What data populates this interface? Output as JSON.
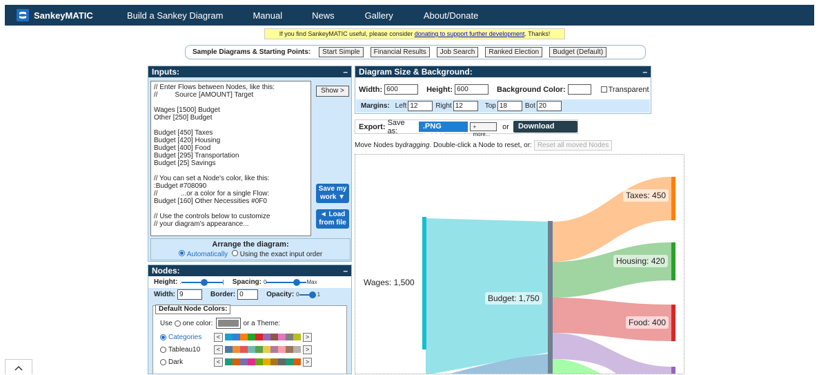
{
  "nav": {
    "brand": "SankeyMATIC",
    "items": [
      "Build a Sankey Diagram",
      "Manual",
      "News",
      "Gallery",
      "About/Donate"
    ]
  },
  "notice": {
    "before": "If you find SankeyMATIC useful, please consider ",
    "link": "donating to support further development",
    "after": ". Thanks!"
  },
  "samples": {
    "label": "Sample Diagrams & Starting Points:",
    "buttons": [
      "Start Simple",
      "Financial Results",
      "Job Search",
      "Ranked Election",
      "Budget (Default)"
    ]
  },
  "inputs": {
    "title": "Inputs:",
    "collapse": "–",
    "text": "// Enter Flows between Nodes, like this:\n//         Source [AMOUNT] Target\n\nWages [1500] Budget\nOther [250] Budget\n\nBudget [450] Taxes\nBudget [420] Housing\nBudget [400] Food\nBudget [295] Transportation\nBudget [25] Savings\n\n// You can set a Node's color, like this:\n:Budget #708090\n//            ...or a color for a single Flow:\nBudget [160] Other Necessities #0F0\n\n// Use the controls below to customize\n// your diagram's appearance...",
    "show_label": "Show >",
    "save_line1": "Save my",
    "save_line2": "work ▼",
    "load_line1": "◄ Load",
    "load_line2": "from file"
  },
  "arrange": {
    "title": "Arrange the diagram:",
    "option_auto": "Automatically",
    "option_exact": "Using the exact input order"
  },
  "nodes": {
    "title": "Nodes:",
    "collapse": "–",
    "height_label": "Height:",
    "height_min": ".",
    "height_max": "|",
    "height_value": 0.55,
    "spacing_label": "Spacing:",
    "spacing_min": "0",
    "spacing_max": "Max",
    "spacing_value": 0.75,
    "width_label": "Width:",
    "width_value": "9",
    "border_label": "Border:",
    "border_value": "0",
    "opacity_label": "Opacity:",
    "opacity_min": "0",
    "opacity_max": "1",
    "opacity_value": 1.0,
    "default_colors_title": "Default Node Colors:",
    "use_label": "Use",
    "one_color_label": "one color:",
    "or_theme_label": "or a Theme:",
    "one_color": "#888888",
    "themes": [
      {
        "name": "Categories",
        "selected": true,
        "colors": [
          "#1f9fc9",
          "#3a7fd1",
          "#ff7f0e",
          "#2ca02c",
          "#d62728",
          "#9467bd",
          "#8c564b",
          "#e377c2",
          "#7f7f7f",
          "#bcbd22"
        ]
      },
      {
        "name": "Tableau10",
        "selected": false,
        "colors": [
          "#4e79a7",
          "#f28e2b",
          "#e15759",
          "#76b7b2",
          "#59a14f",
          "#edc948",
          "#b07aa1",
          "#ff9da7",
          "#9c755f",
          "#bab0ac"
        ]
      },
      {
        "name": "Dark",
        "selected": false,
        "colors": [
          "#1b9e77",
          "#d95f02",
          "#7570b3",
          "#e7298a",
          "#66a61e",
          "#e6ab02",
          "#a6761d",
          "#666666",
          "#1b9e77",
          "#d95f02"
        ]
      }
    ],
    "prev": "<",
    "next": ">"
  },
  "size": {
    "title": "Diagram Size & Background:",
    "collapse": "–",
    "width_label": "Width:",
    "width_value": "600",
    "height_label": "Height:",
    "height_value": "600",
    "bg_label": "Background Color:",
    "bg_color": "#ffffff",
    "transparent_label": "Transparent",
    "margins_label": "Margins:",
    "left_label": "Left",
    "left_value": "12",
    "right_label": "Right",
    "right_value": "12",
    "top_label": "Top",
    "top_value": "18",
    "bot_label": "Bot",
    "bot_value": "20"
  },
  "export": {
    "label": "Export:",
    "save_as": "Save as:",
    "png": ".PNG image",
    "more": "+ more...",
    "or": "or",
    "svg": "Download .SVG"
  },
  "move": {
    "before": "Move Nodes by ",
    "em": "dragging",
    "after": ". Double-click a Node to reset, or:",
    "reset": "Reset all moved Nodes"
  },
  "diagram": {
    "labels": {
      "wages": "Wages: 1,500",
      "budget": "Budget: 1,750",
      "taxes": "Taxes: 450",
      "housing": "Housing: 420",
      "food": "Food: 400"
    },
    "colors": {
      "wages": "#17becf",
      "budget": "#708090",
      "taxes": "#ff7f0e",
      "housing": "#2ca02c",
      "food": "#d62728",
      "transport": "#9467bd",
      "other": "#1f77b4",
      "necessities": "#00ff00"
    }
  },
  "back_top": "^"
}
